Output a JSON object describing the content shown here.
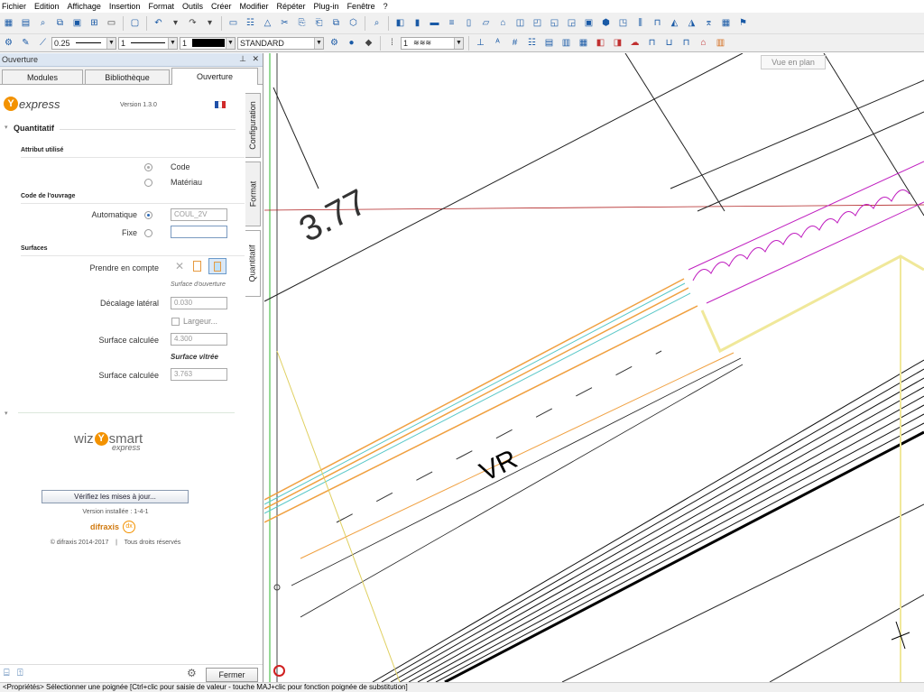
{
  "menu": [
    "Fichier",
    "Edition",
    "Affichage",
    "Insertion",
    "Format",
    "Outils",
    "Créer",
    "Modifier",
    "Répéter",
    "Plug-in",
    "Fenêtre",
    "?"
  ],
  "toolbar2": {
    "pen_value": "0.25",
    "line_value": "1",
    "color_value": "1",
    "layer_value": "STANDARD",
    "hatch_value": "1"
  },
  "panel": {
    "title": "Ouverture",
    "tabs": [
      "Modules",
      "Bibliothèque",
      "Ouverture"
    ],
    "vtabs": [
      "Configuration",
      "Format",
      "Quantitatif"
    ],
    "logo_text": "express",
    "version": "Version 1.3.0",
    "section": "Quantitatif",
    "attr_header": "Attribut utilisé",
    "attr_code": "Code",
    "attr_material": "Matériau",
    "code_header": "Code de l'ouvrage",
    "auto_label": "Automatique",
    "auto_value": "COUL_2V",
    "fixe_label": "Fixe",
    "surf_header": "Surfaces",
    "take_label": "Prendre en compte",
    "surf_opening": "Surface d'ouverture",
    "lateral_label": "Décalage latéral",
    "lateral_value": "0.030",
    "width_label": "Largeur...",
    "calc_label": "Surface calculée",
    "calc_value": "4.300",
    "glass_title": "Surface vitrée",
    "glass_label": "Surface calculée",
    "glass_value": "3.763",
    "wiz_prefix": "wiz",
    "wiz_suffix": "smart",
    "wiz_express": "express",
    "update_btn": "Vérifiez les mises à jour...",
    "installed": "Version installée : 1-4-1",
    "difraxis": "difraxis",
    "copyright": "© difraxis 2014-2017    |    Tous droits réservés",
    "close_btn": "Fermer"
  },
  "canvas": {
    "view_label": "Vue en plan",
    "dim_text": "3.77",
    "vr_text": "VR"
  },
  "status": "<Propriétés> Sélectionner une poignée [Ctrl+clic pour saisie de valeur - touche MAJ+clic pour fonction poignée de substitution]"
}
